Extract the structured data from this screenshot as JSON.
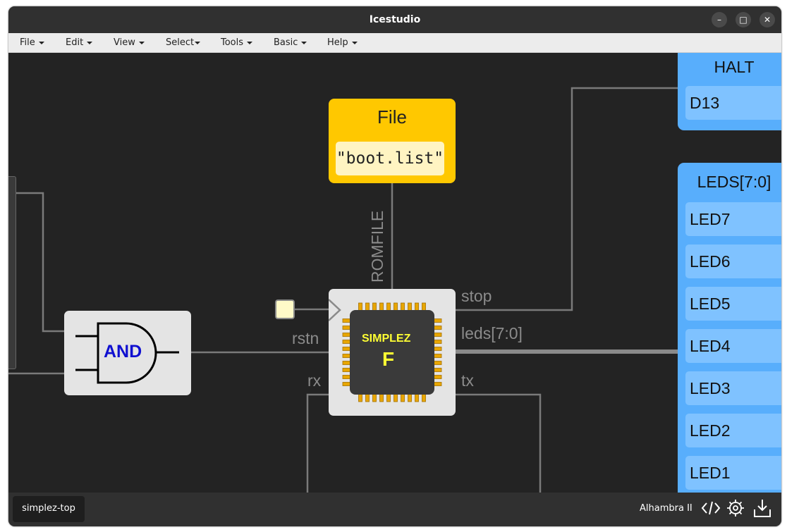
{
  "window": {
    "title": "Icestudio"
  },
  "titlebar_buttons": [
    {
      "name": "minimize",
      "glyph": "–"
    },
    {
      "name": "maximize",
      "glyph": "□"
    },
    {
      "name": "close",
      "glyph": "✕"
    }
  ],
  "menu": [
    {
      "label": "File"
    },
    {
      "label": "Edit"
    },
    {
      "label": "View"
    },
    {
      "label": "Select"
    },
    {
      "label": "Tools"
    },
    {
      "label": "Basic"
    },
    {
      "label": "Help"
    }
  ],
  "canvas": {
    "file_block": {
      "title": "File",
      "value": "\"boot.list\""
    },
    "and_block": {
      "label": "AND"
    },
    "simplez_block": {
      "name": "SIMPLEZ",
      "variant": "F"
    },
    "ports": {
      "romfile": "ROMFILE",
      "rstn": "rstn",
      "rx": "rx",
      "stop": "stop",
      "leds": "leds[7:0]",
      "tx": "tx"
    },
    "halt_block": {
      "title": "HALT",
      "pins": [
        "D13"
      ]
    },
    "leds_block": {
      "title": "LEDS[7:0]",
      "items": [
        "LED7",
        "LED6",
        "LED5",
        "LED4",
        "LED3",
        "LED2",
        "LED1"
      ]
    }
  },
  "statusbar": {
    "tab_label": "simplez-top",
    "board": "Alhambra II",
    "icons": [
      "code-icon",
      "settings-icon",
      "download-icon"
    ]
  },
  "colors": {
    "canvas_bg": "#232323",
    "wire": "#7a7a7a",
    "file_block": "#ffc800",
    "io_block": "#58aefc",
    "and_text": "#1010d0",
    "chip_text": "#ffff33"
  }
}
